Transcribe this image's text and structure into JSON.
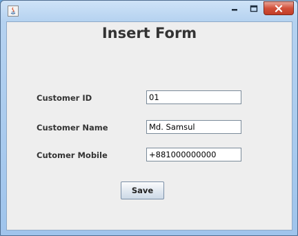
{
  "window": {
    "title": "",
    "icons": {
      "app": "java-app-icon",
      "minimize": "minimize-icon",
      "maximize": "maximize-icon",
      "close": "close-icon"
    },
    "colors": {
      "frame": "#9fc4ec",
      "close_button": "#d2503a",
      "client_background": "#eeeeee"
    }
  },
  "form": {
    "title": "Insert Form",
    "fields": [
      {
        "label": "Customer ID",
        "value": "01"
      },
      {
        "label": "Customer Name",
        "value": "Md. Samsul"
      },
      {
        "label": "Cutomer Mobile",
        "value": "+881000000000"
      }
    ],
    "save_label": "Save"
  }
}
